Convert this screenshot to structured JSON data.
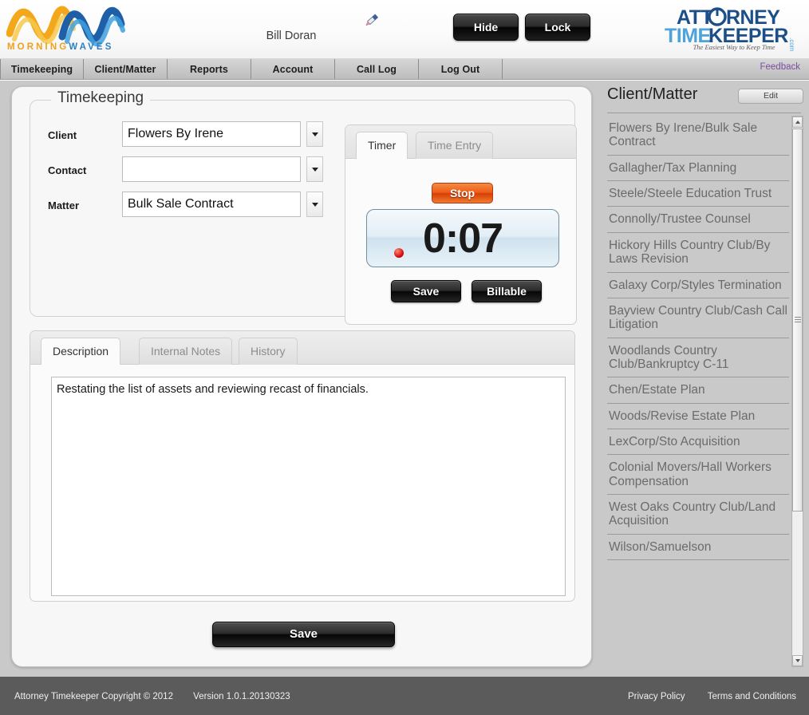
{
  "header": {
    "brand_logo": "morningwaves-logo",
    "brand_word_1": "MORNING",
    "brand_word_2": "WAVES",
    "user_name": "Bill Doran",
    "edit_user_icon": "pencil-icon",
    "hide_button": "Hide",
    "lock_button": "Lock",
    "product_logo_line1": "ATTORNEY",
    "product_logo_line2": "TIMEKEEPER",
    "product_logo_suffix": ".com",
    "product_tagline": "The Easiest Way to Keep Time"
  },
  "nav": {
    "items": [
      {
        "label": "Timekeeping"
      },
      {
        "label": "Client/Matter"
      },
      {
        "label": "Reports"
      },
      {
        "label": "Account"
      },
      {
        "label": "Call Log"
      },
      {
        "label": "Log Out"
      }
    ],
    "feedback_label": "Feedback"
  },
  "timekeeping": {
    "legend": "Timekeeping",
    "fields": [
      {
        "label": "Client",
        "value": "Flowers By Irene",
        "placeholder": ""
      },
      {
        "label": "Contact",
        "value": "",
        "placeholder": ""
      },
      {
        "label": "Matter",
        "value": "Bulk Sale Contract",
        "placeholder": ""
      }
    ]
  },
  "timer": {
    "tabs": [
      {
        "label": "Timer",
        "active": true
      },
      {
        "label": "Time Entry",
        "active": false
      }
    ],
    "stop_label": "Stop",
    "elapsed": "0:07",
    "running_indicator": "recording-dot",
    "save_label": "Save",
    "billable_label": "Billable",
    "stop_color": "#ee5a18",
    "indicator_color": "#cc0000"
  },
  "notes": {
    "tabs": [
      {
        "label": "Description",
        "active": true
      },
      {
        "label": "Internal Notes",
        "active": false
      },
      {
        "label": "History",
        "active": false
      }
    ],
    "description_text": "Restating the list of assets and reviewing recast of financials.",
    "description_placeholder": ""
  },
  "main_save_label": "Save",
  "sidebar": {
    "title": "Client/Matter",
    "edit_label": "Edit",
    "items": [
      {
        "label": "Flowers By Irene/Bulk Sale Contract"
      },
      {
        "label": "Gallagher/Tax Planning"
      },
      {
        "label": "Steele/Steele Education Trust"
      },
      {
        "label": "Connolly/Trustee Counsel"
      },
      {
        "label": "Hickory Hills Country Club/By Laws Revision"
      },
      {
        "label": "Galaxy Corp/Styles Termination"
      },
      {
        "label": "Bayview Country Club/Cash Call Litigation"
      },
      {
        "label": "Woodlands Country Club/Bankruptcy C-11"
      },
      {
        "label": "Chen/Estate Plan"
      },
      {
        "label": "Woods/Revise Estate Plan"
      },
      {
        "label": "LexCorp/Sto Acquisition"
      },
      {
        "label": "Colonial Movers/Hall Workers Compensation"
      },
      {
        "label": "West Oaks Country Club/Land Acquisition"
      },
      {
        "label": "Wilson/Samuelson"
      }
    ]
  },
  "footer": {
    "copyright": "Attorney Timekeeper Copyright © 2012",
    "version": "Version 1.0.1.20130323",
    "privacy_policy": "Privacy Policy",
    "terms": "Terms and Conditions"
  }
}
